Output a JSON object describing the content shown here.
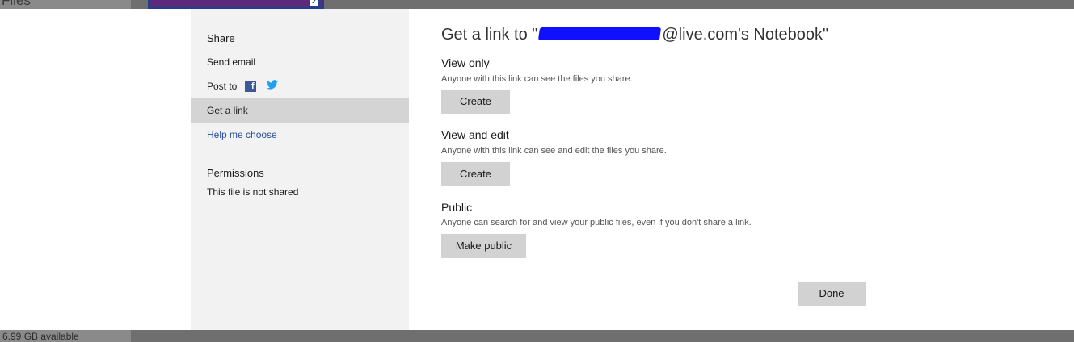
{
  "background": {
    "files_label": "Files",
    "storage_label": "6.99 GB available"
  },
  "sidebar": {
    "share_heading": "Share",
    "items": [
      {
        "label": "Send email"
      },
      {
        "label": "Post to"
      },
      {
        "label": "Get a link",
        "active": true
      },
      {
        "label": "Help me choose"
      }
    ],
    "social_icons": [
      "facebook-icon",
      "twitter-icon"
    ],
    "permissions_heading": "Permissions",
    "permissions_text": "This file is not shared"
  },
  "main": {
    "title_prefix": "Get a link to \"",
    "title_suffix": "@live.com's Notebook\"",
    "options": [
      {
        "title": "View only",
        "description": "Anyone with this link can see the files you share.",
        "button": "Create"
      },
      {
        "title": "View and edit",
        "description": "Anyone with this link can see and edit the files you share.",
        "button": "Create"
      },
      {
        "title": "Public",
        "description": "Anyone can search for and view your public files, even if you don't share a link.",
        "button": "Make public"
      }
    ],
    "done_button": "Done"
  },
  "colors": {
    "sidebar_bg": "#f2f2f2",
    "active_item_bg": "#d4d4d4",
    "link_color": "#2a4fa0",
    "button_bg": "#d2d2d2",
    "redaction": "#1010ff"
  }
}
